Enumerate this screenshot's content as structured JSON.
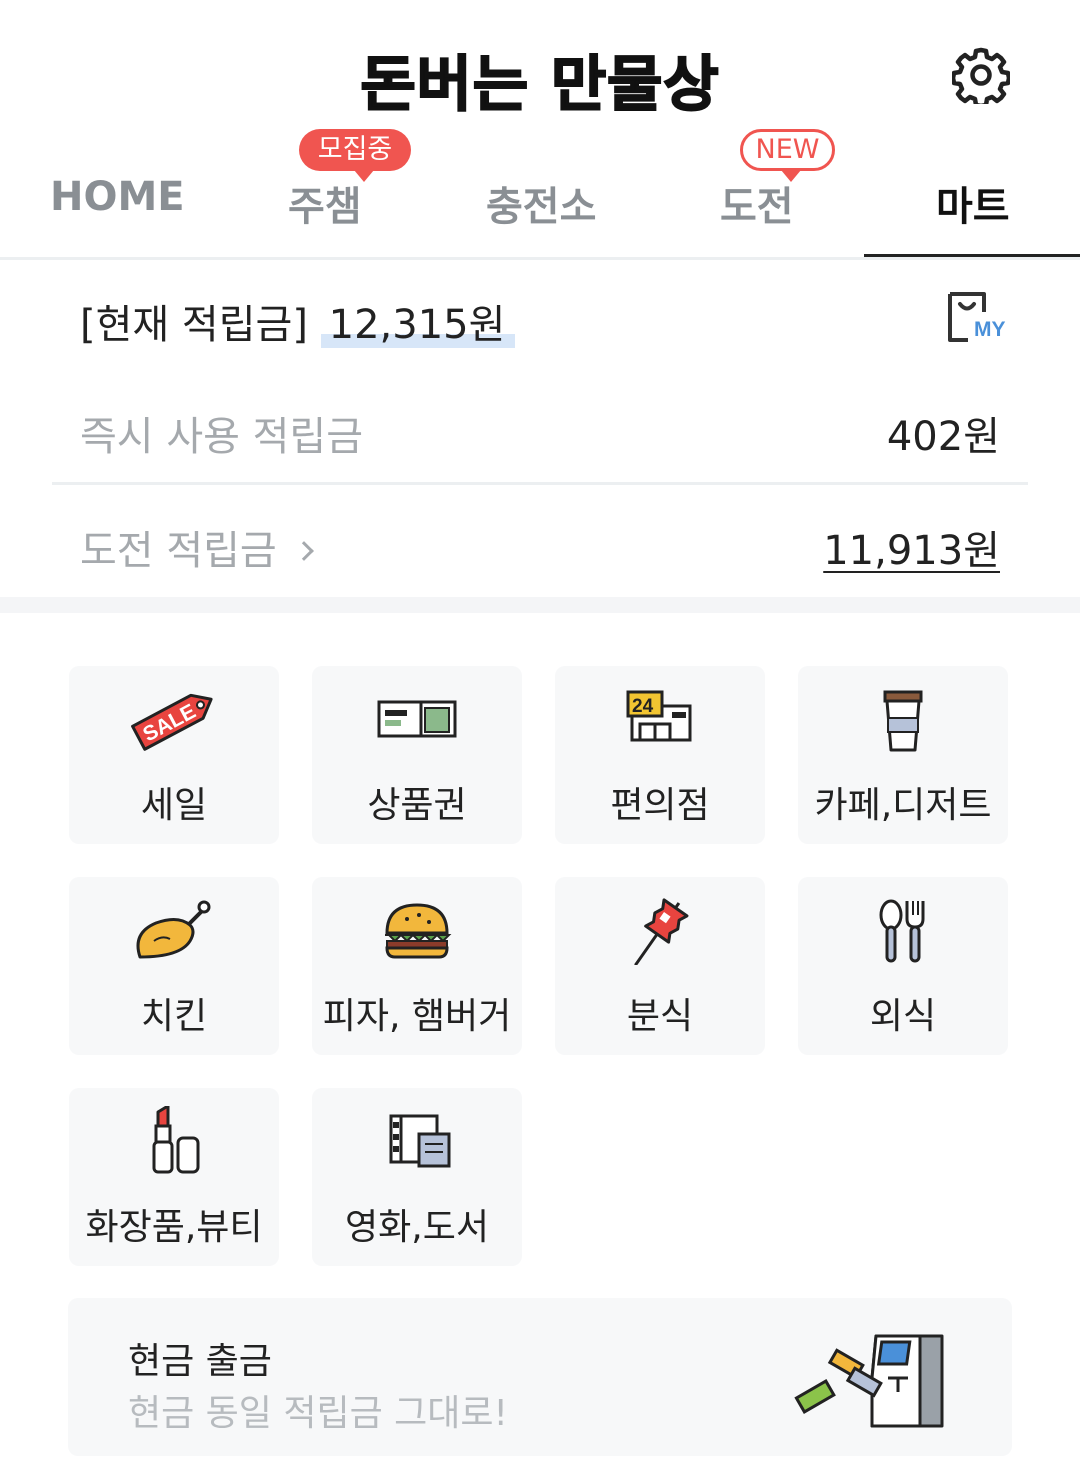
{
  "header": {
    "title": "돈버는 만물상",
    "settings_icon": "gear-icon"
  },
  "tabs": [
    {
      "label": "HOME"
    },
    {
      "label": "주챔",
      "badge": "모집중"
    },
    {
      "label": "충전소"
    },
    {
      "label": "도전",
      "badge": "NEW"
    },
    {
      "label": "마트",
      "active": true
    }
  ],
  "points": {
    "current_label": "[현재 적립금]",
    "current_amount": "12,315원",
    "my_icon_text": "MY",
    "instant_label": "즉시 사용 적립금",
    "instant_amount": "402원",
    "challenge_label": "도전 적립금",
    "challenge_amount": "11,913원"
  },
  "categories": [
    {
      "label": "세일",
      "icon": "sale-tag-icon",
      "icon_text": "SALE"
    },
    {
      "label": "상품권",
      "icon": "gift-card-icon"
    },
    {
      "label": "편의점",
      "icon": "convenience-store-icon",
      "icon_text": "24"
    },
    {
      "label": "카페,디저트",
      "icon": "coffee-cup-icon"
    },
    {
      "label": "치킨",
      "icon": "chicken-icon"
    },
    {
      "label": "피자, 햄버거",
      "icon": "burger-icon"
    },
    {
      "label": "분식",
      "icon": "skewer-icon"
    },
    {
      "label": "외식",
      "icon": "cutlery-icon"
    },
    {
      "label": "화장품,뷰티",
      "icon": "lipstick-icon"
    },
    {
      "label": "영화,도서",
      "icon": "film-book-icon"
    }
  ],
  "cash_out": {
    "title": "현금 출금",
    "subtitle": "현금 동일 적립금 그대로!",
    "icon": "atm-icon"
  },
  "colors": {
    "accent": "#f05550",
    "highlight": "#d7e6f8",
    "tile_bg": "#f7f8f9"
  }
}
